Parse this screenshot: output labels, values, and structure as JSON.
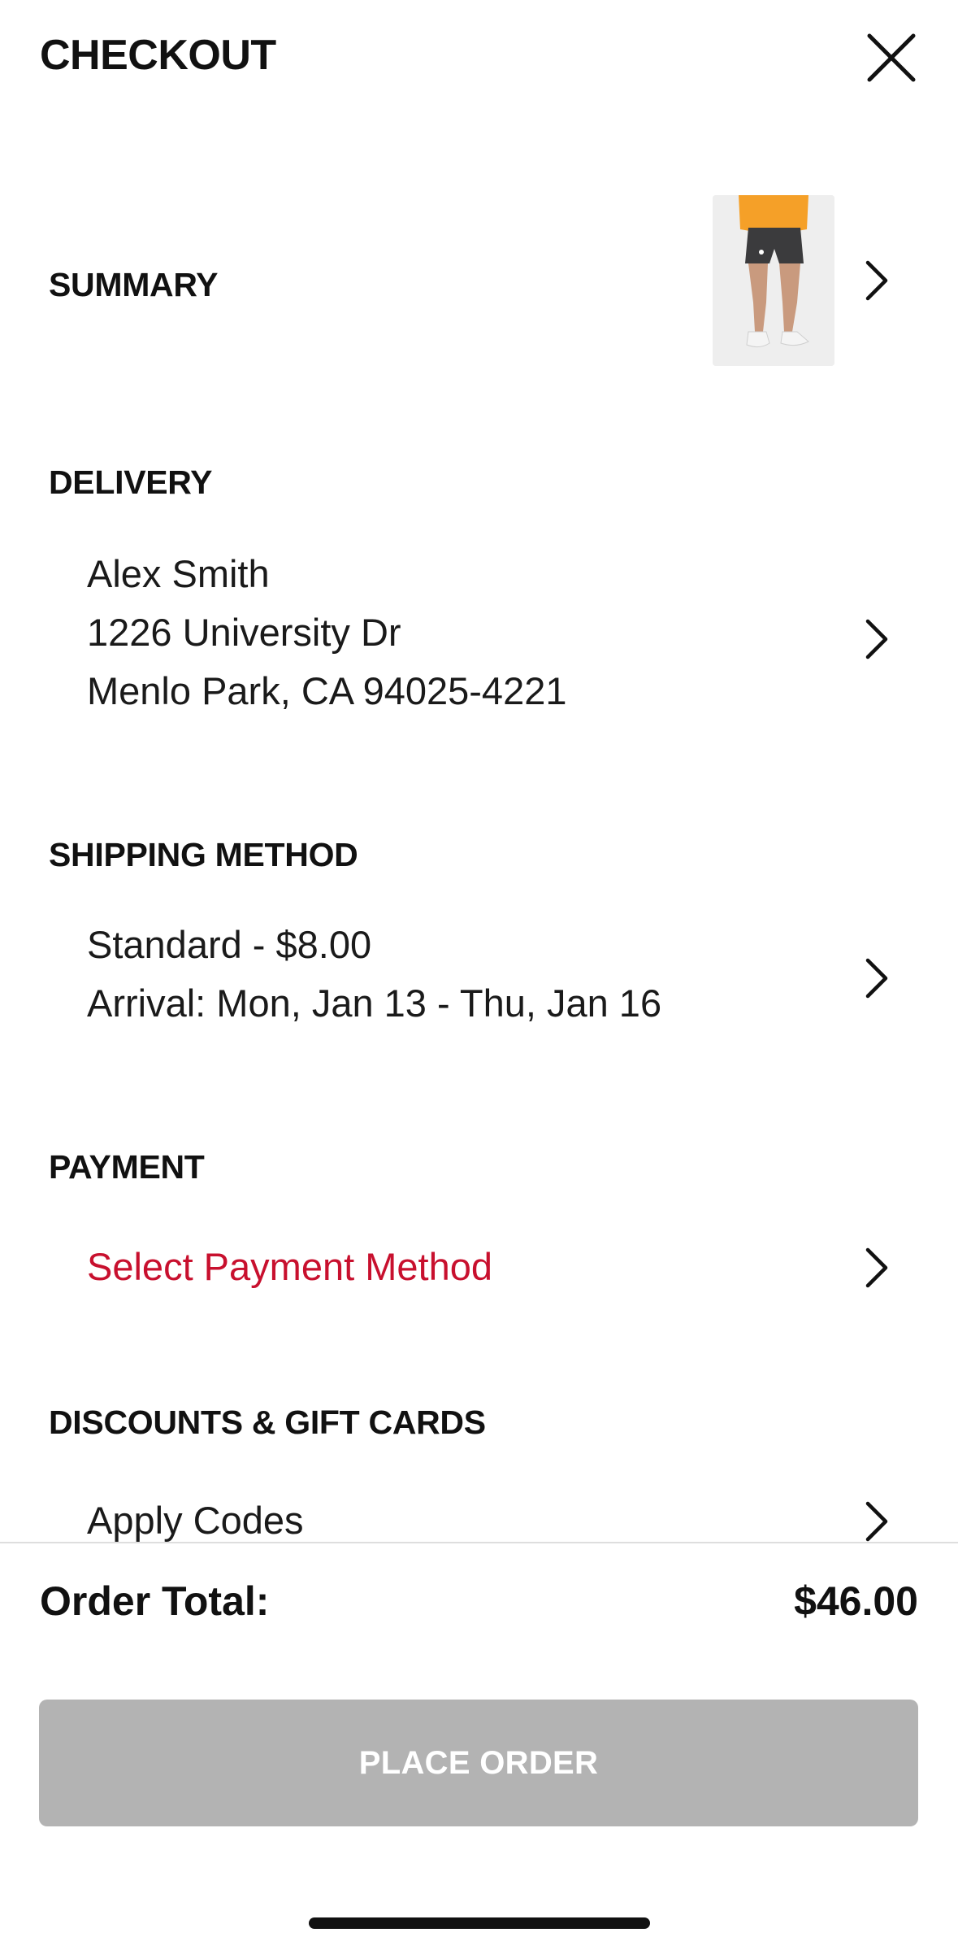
{
  "header": {
    "title": "CHECKOUT",
    "close_icon": "close-icon"
  },
  "summary": {
    "title": "SUMMARY",
    "thumbnail_icon": "product-image-shorts"
  },
  "delivery": {
    "title": "DELIVERY",
    "name": "Alex Smith",
    "address_line": "1226 University Dr",
    "city_line": "Menlo Park, CA 94025-4221"
  },
  "shipping": {
    "title": "SHIPPING METHOD",
    "method": "Standard - $8.00",
    "arrival": "Arrival: Mon, Jan 13 - Thu, Jan 16"
  },
  "payment": {
    "title": "PAYMENT",
    "select_label": "Select Payment Method",
    "link_color": "#c8102e"
  },
  "discounts": {
    "title": "DISCOUNTS & GIFT CARDS",
    "apply_label": "Apply Codes"
  },
  "footer": {
    "total_label": "Order Total:",
    "total_value": "$46.00",
    "place_order_label": "PLACE ORDER",
    "place_order_color": "#b3b3b3"
  }
}
